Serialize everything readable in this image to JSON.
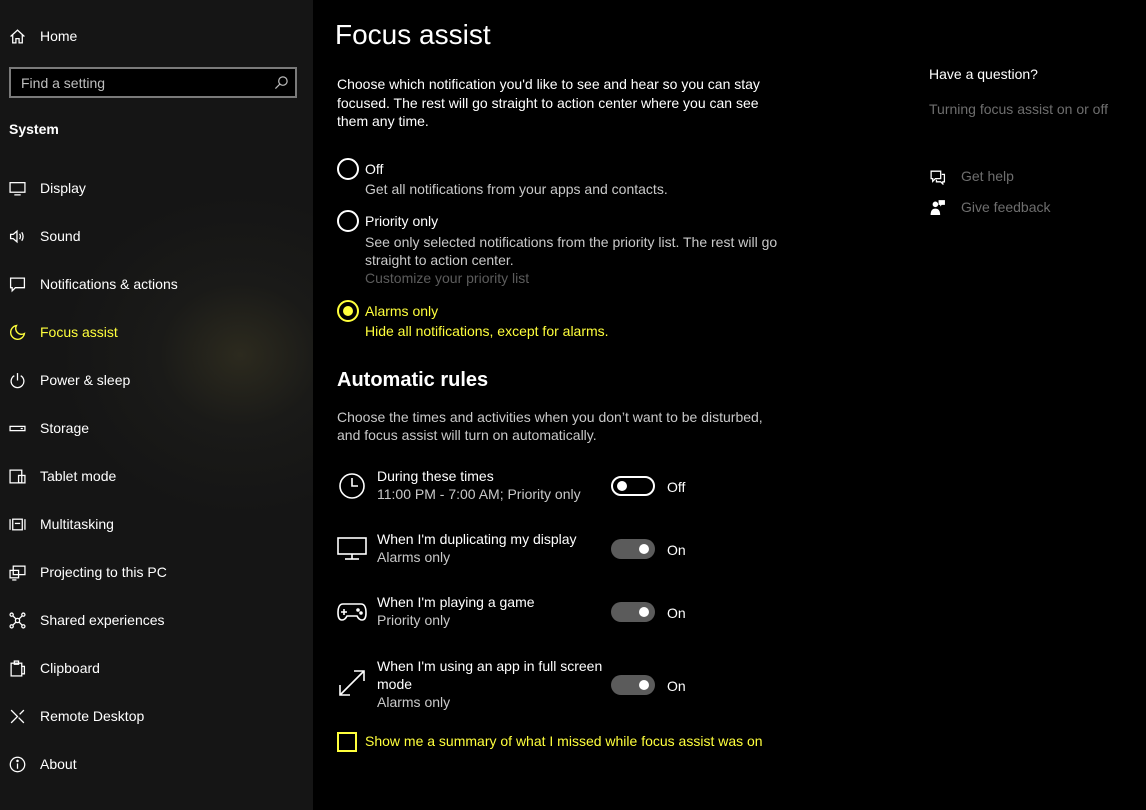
{
  "sidebar": {
    "home_label": "Home",
    "search_placeholder": "Find a setting",
    "section_title": "System",
    "items": [
      {
        "label": "Display",
        "icon": "monitor-icon"
      },
      {
        "label": "Sound",
        "icon": "speaker-icon"
      },
      {
        "label": "Notifications & actions",
        "icon": "notification-icon"
      },
      {
        "label": "Focus assist",
        "icon": "moon-icon",
        "active": true
      },
      {
        "label": "Power & sleep",
        "icon": "power-icon"
      },
      {
        "label": "Storage",
        "icon": "storage-icon"
      },
      {
        "label": "Tablet mode",
        "icon": "tablet-icon"
      },
      {
        "label": "Multitasking",
        "icon": "multitasking-icon"
      },
      {
        "label": "Projecting to this PC",
        "icon": "projecting-icon"
      },
      {
        "label": "Shared experiences",
        "icon": "shared-icon"
      },
      {
        "label": "Clipboard",
        "icon": "clipboard-icon"
      },
      {
        "label": "Remote Desktop",
        "icon": "remote-desktop-icon"
      },
      {
        "label": "About",
        "icon": "info-icon"
      }
    ]
  },
  "main": {
    "title": "Focus assist",
    "description": "Choose which notification you'd like to see and hear so you can stay focused. The rest will go straight to action center where you can see them any time.",
    "options": [
      {
        "label": "Off",
        "sub": "Get all notifications from your apps and contacts.",
        "selected": false
      },
      {
        "label": "Priority only",
        "sub": "See only selected notifications from the priority list. The rest will go straight to action center.",
        "link": "Customize your priority list",
        "selected": false
      },
      {
        "label": "Alarms only",
        "sub": "Hide all notifications, except for alarms.",
        "selected": true
      }
    ],
    "rules_title": "Automatic rules",
    "rules_description": "Choose the times and activities when you don’t want to be disturbed, and focus assist will turn on automatically.",
    "rules": [
      {
        "title": "During these times",
        "sub": "11:00 PM - 7:00 AM; Priority only",
        "state": "Off",
        "icon": "clock-icon"
      },
      {
        "title": "When I'm duplicating my display",
        "sub": "Alarms only",
        "state": "On",
        "icon": "monitor-icon"
      },
      {
        "title": "When I'm playing a game",
        "sub": "Priority only",
        "state": "On",
        "icon": "gamepad-icon"
      },
      {
        "title": "When I'm using an app in full screen mode",
        "sub": "Alarms only",
        "state": "On",
        "icon": "fullscreen-icon"
      }
    ],
    "summary_checkbox_label": "Show me a summary of what I missed while focus assist was on"
  },
  "help": {
    "question": "Have a question?",
    "link": "Turning focus assist on or off",
    "get_help": "Get help",
    "give_feedback": "Give feedback"
  },
  "colors": {
    "accent": "#ffff3c",
    "background": "#000000",
    "sidebar": "#171717",
    "muted_text": "#c9c9c9",
    "disabled_text": "#6e6e6e"
  }
}
